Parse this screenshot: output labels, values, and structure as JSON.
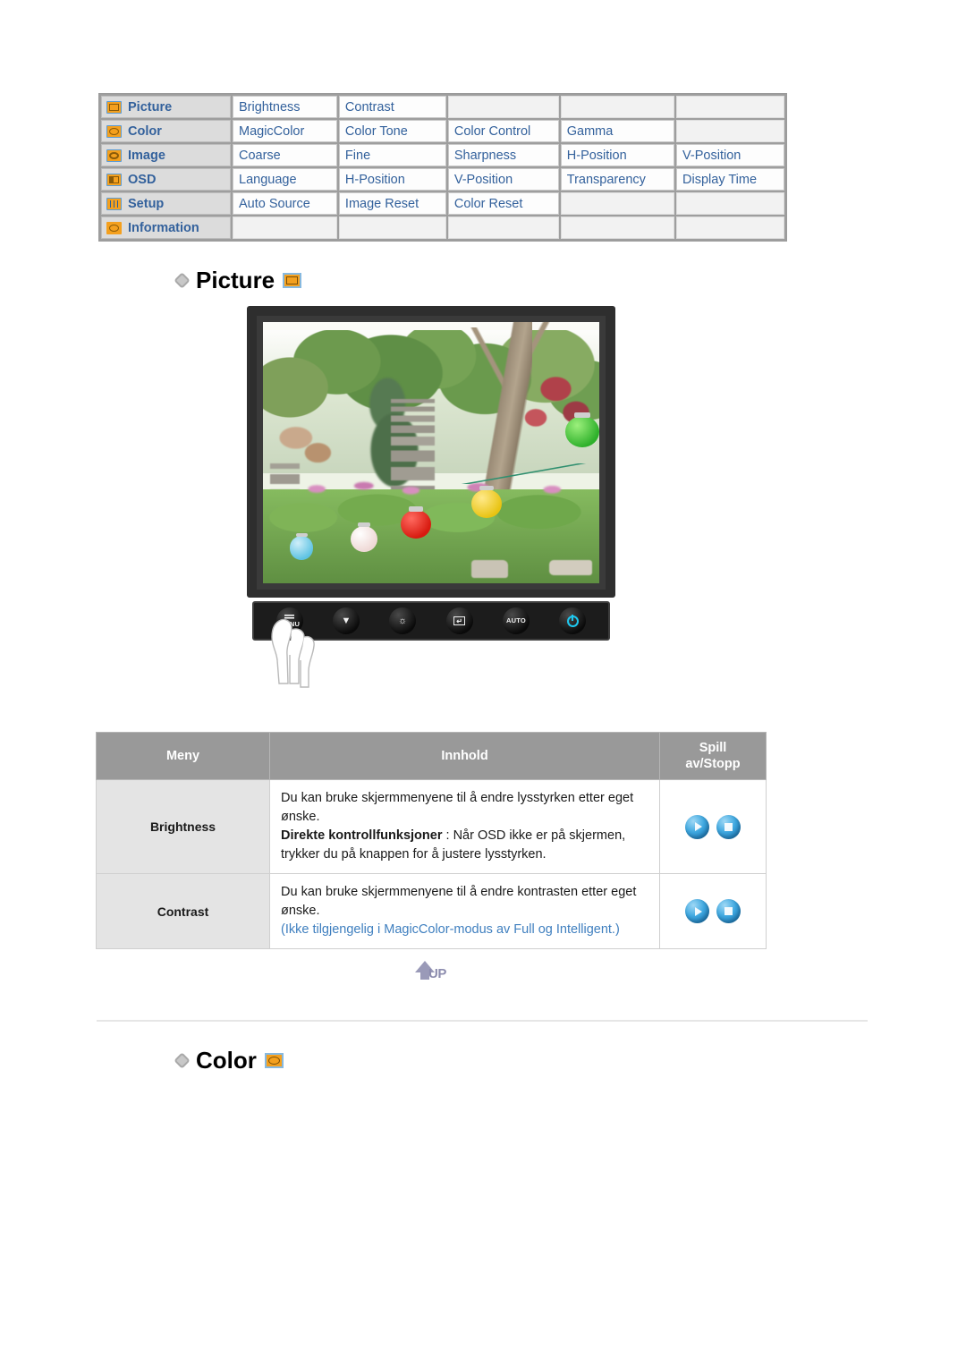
{
  "nav_table": {
    "rows": [
      {
        "menu": "Picture",
        "icon": "picture-icon",
        "items": [
          "Brightness",
          "Contrast",
          "",
          "",
          ""
        ]
      },
      {
        "menu": "Color",
        "icon": "color-icon",
        "items": [
          "MagicColor",
          "Color Tone",
          "Color Control",
          "Gamma",
          ""
        ]
      },
      {
        "menu": "Image",
        "icon": "image-icon",
        "items": [
          "Coarse",
          "Fine",
          "Sharpness",
          "H-Position",
          "V-Position"
        ]
      },
      {
        "menu": "OSD",
        "icon": "osd-icon",
        "items": [
          "Language",
          "H-Position",
          "V-Position",
          "Transparency",
          "Display Time"
        ]
      },
      {
        "menu": "Setup",
        "icon": "setup-icon",
        "items": [
          "Auto Source",
          "Image Reset",
          "Color Reset",
          "",
          ""
        ]
      },
      {
        "menu": "Information",
        "icon": "information-icon",
        "items": [
          "",
          "",
          "",
          "",
          ""
        ]
      }
    ]
  },
  "sections": {
    "picture": {
      "title": "Picture",
      "icon": "picture-icon"
    },
    "color": {
      "title": "Color",
      "icon": "color-icon"
    }
  },
  "monitor": {
    "buttons": [
      {
        "name": "menu-button",
        "label": "MENU"
      },
      {
        "name": "down-button",
        "label": ""
      },
      {
        "name": "brightness-button",
        "label": ""
      },
      {
        "name": "enter-button",
        "label": ""
      },
      {
        "name": "auto-button",
        "label": "AUTO"
      },
      {
        "name": "power-button",
        "label": ""
      }
    ]
  },
  "content_table": {
    "headers": {
      "menu": "Meny",
      "content": "Innhold",
      "play": "Spill",
      "play2": "av/Stopp"
    },
    "rows": [
      {
        "menu": "Brightness",
        "line1": "Du kan bruke skjermmenyene til å endre lysstyrken etter eget ønske.",
        "bold": "Direkte kontrollfunksjoner",
        "after_bold": " : Når OSD ikke er på skjermen, trykker du på knappen for å justere lysstyrken.",
        "note": ""
      },
      {
        "menu": "Contrast",
        "line1": "Du kan bruke skjermmenyene til å endre kontrasten etter eget ønske.",
        "bold": "",
        "after_bold": "",
        "note": "(Ikke tilgjengelig i MagicColor-modus av Full og Intelligent.)"
      }
    ]
  },
  "up_button": {
    "label": "UP"
  },
  "colors": {
    "nav_text": "#33619c",
    "icon_orange": "#f4a01e",
    "icon_blue": "#5b9bd5",
    "header_gray": "#999999",
    "note_blue": "#3f7fbf",
    "ball_blue": "#1274bb"
  }
}
